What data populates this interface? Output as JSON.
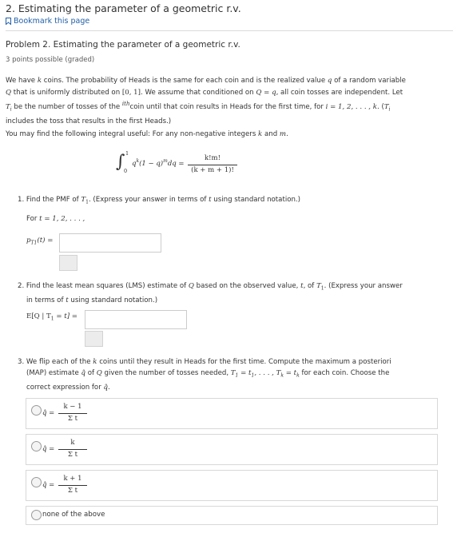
{
  "header": {
    "title": "2. Estimating the parameter of a geometric r.v.",
    "bookmark_label": "Bookmark this page"
  },
  "problem": {
    "title": "Problem 2. Estimating the parameter of a geometric r.v.",
    "points": "3 points possible (graded)",
    "intro_1a": "We have ",
    "intro_1b": " coins. The probability of Heads is the same for each coin and is the realized value ",
    "intro_1c": " of a random variable",
    "intro_2a": " that is uniformly distributed on ",
    "intro_2b": ". We assume that conditioned on ",
    "intro_2c": ", all coin tosses are independent. Let",
    "intro_3a": " be the number of tosses of the ",
    "intro_3b": "coin until that coin results in Heads for the first time, for ",
    "intro_3c": ". (",
    "intro_4": "includes the toss that results in the first Heads.)",
    "hint_a": "You may find the following integral useful: For any non-negative integers ",
    "hint_b": " and "
  },
  "math": {
    "k": "k",
    "q": "q",
    "Q": "Q",
    "interval": "[0, 1]",
    "Qeq": "Q = q",
    "Ti": "T",
    "sub_i": "i",
    "ith": "ith",
    "range": "i = 1, 2, . . . , k",
    "m": "m",
    "integral_lhs": "q",
    "integral_upper": "1",
    "integral_lower": "0",
    "frac_num": "k!m!",
    "frac_den": "(k + m + 1)!"
  },
  "q1": {
    "text_a": "1. Find the PMF of ",
    "text_b": ". (Express your answer in terms of ",
    "text_c": " using standard notation.)",
    "for_label": "For ",
    "for_math": "t = 1, 2, . . . ,",
    "pmf_label": "p",
    "input_value": ""
  },
  "q2": {
    "line1_a": "2. Find the least mean squares (LMS) estimate of ",
    "line1_b": " based on the observed value, ",
    "line1_c": ", of ",
    "line1_d": ". (Express your answer",
    "line2_a": "in terms of ",
    "line2_b": " using standard notation.)",
    "exp_label": "E[Q | T",
    "input_value": ""
  },
  "q3": {
    "line1_a": "3. We flip each of the ",
    "line1_b": " coins until they result in Heads for the first time. Compute the maximum a posteriori",
    "line2_a": "(MAP) estimate ",
    "line2_b": " of ",
    "line2_c": " given the number of tosses needed, ",
    "line2_d": " for each coin. Choose the",
    "line3": "correct expression for ",
    "options": [
      {
        "num": "k − 1",
        "den": "Σ t"
      },
      {
        "num": "k",
        "den": "Σ t"
      },
      {
        "num": "k + 1",
        "den": "Σ t"
      }
    ],
    "option_none": "none of the above"
  }
}
